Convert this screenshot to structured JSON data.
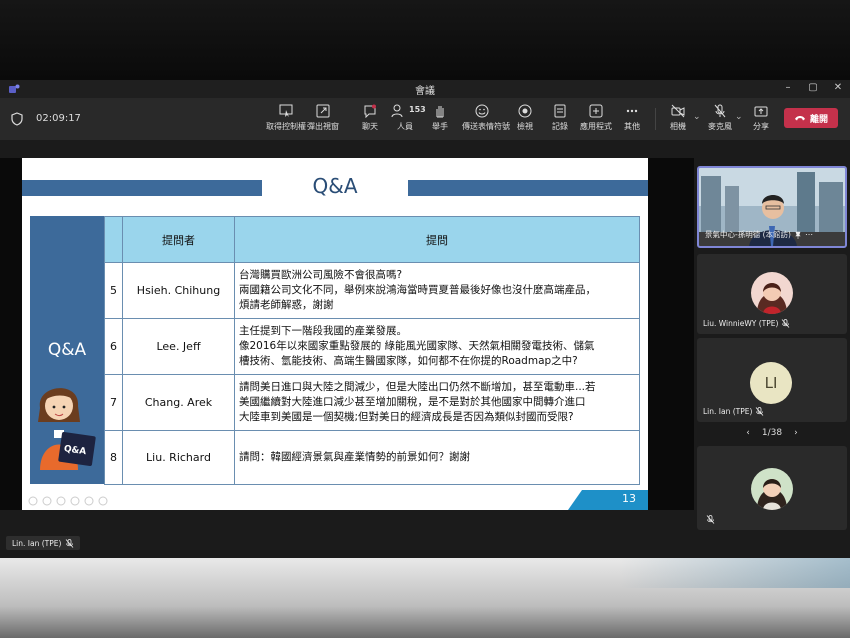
{
  "window": {
    "title": "會議",
    "controls": [
      "–",
      "▢",
      "✕"
    ]
  },
  "toolbar": {
    "timer": "02:09:17",
    "buttons": [
      {
        "icon": "take-control-icon",
        "label": "取得控制權"
      },
      {
        "icon": "popout-icon",
        "label": "彈出視窗"
      },
      {
        "icon": "chat-icon",
        "label": "聊天"
      },
      {
        "icon": "people-icon",
        "label": "人員",
        "count": "153"
      },
      {
        "icon": "raise-hand-icon",
        "label": "舉手"
      },
      {
        "icon": "reactions-icon",
        "label": "傳送表情符號"
      },
      {
        "icon": "view-icon",
        "label": "檢視"
      },
      {
        "icon": "notes-icon",
        "label": "記錄"
      },
      {
        "icon": "apps-icon",
        "label": "應用程式"
      },
      {
        "icon": "more-icon",
        "label": "其他"
      },
      {
        "icon": "camera-off-icon",
        "label": "相機"
      },
      {
        "icon": "mic-off-icon",
        "label": "麥克風"
      },
      {
        "icon": "share-icon",
        "label": "分享"
      }
    ],
    "leave_label": "離開",
    "accent_leave": "#c4314b"
  },
  "slide": {
    "title": "Q&A",
    "side_label": "Q&A",
    "page_number": "13",
    "table": {
      "headers": [
        "",
        "提問者",
        "提問"
      ],
      "rows": [
        {
          "no": "5",
          "asker": "Hsieh. Chihung",
          "lines": [
            "台灣購買歐洲公司風險不會很高嗎?",
            "兩國籍公司文化不同，舉例來說鴻海當時買夏普最後好像也沒什麼高端產品，",
            "煩請老師解惑，謝謝"
          ]
        },
        {
          "no": "6",
          "asker": "Lee. Jeff",
          "lines": [
            "主任提到下一階段我國的產業發展。",
            "像2016年以來國家重點發展的 綠能風光國家隊、天然氣相關發電技術、儲氣",
            "槽技術、氫能技術、高端生醫國家隊，如何都不在你提的Roadmap之中?"
          ]
        },
        {
          "no": "7",
          "asker": "Chang. Arek",
          "lines": [
            "請問美日進口與大陸之間減少，但是大陸出口仍然不斷增加，甚至電動車...若",
            "美國繼續對大陸進口減少甚至增加關稅，是不是對於其他國家中間轉介進口",
            "大陸車到美國是一個契機;但對美日的經濟成長是否因為類似封國而受限?"
          ]
        },
        {
          "no": "8",
          "asker": "Liu. Richard",
          "lines": [
            "請問：韓國經濟景氣與產業情勢的前景如何？謝謝"
          ]
        }
      ]
    },
    "colors": {
      "header_bar": "#3d6a9a",
      "table_header": "#9ad5ec",
      "footer": "#1e90c8"
    }
  },
  "participants": {
    "tiles": [
      {
        "name": "景氣中心-孫明德 (本館訪)",
        "type": "video",
        "active": true
      },
      {
        "name": "Liu. WinnieWY (TPE)",
        "type": "photo"
      },
      {
        "name": "Lin. Ian (TPE)",
        "type": "initials",
        "initials": "LI"
      },
      {
        "name": "",
        "type": "photo"
      }
    ],
    "pager": {
      "prev": "‹",
      "label": "1/38",
      "next": "›"
    }
  },
  "self_view": {
    "name": "Lin. Ian (TPE)"
  }
}
